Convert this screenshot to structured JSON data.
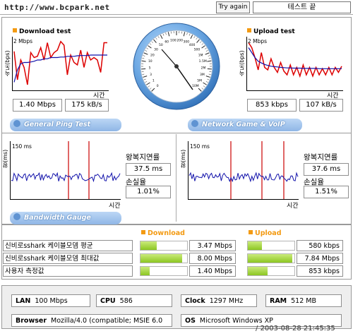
{
  "header": {
    "url": "http://www.bcpark.net",
    "try_again": "Try again",
    "test_end": "테스트 끝"
  },
  "download": {
    "title": "Download test",
    "y_label": "속도(bps)",
    "scale": "2 Mbps",
    "x_label": "시간",
    "mbps": "1.40 Mbps",
    "kbs": "175 kB/s",
    "speed_series": [
      1.55,
      0.4,
      1.2,
      0.9,
      0.2,
      1.5,
      1.3,
      1.35,
      1.7,
      1.2,
      1.9,
      1.3,
      1.5,
      1.6,
      1.95,
      1.8,
      0.6,
      1.4,
      1.1,
      1.0,
      1.6,
      0.9,
      1.5,
      1.2,
      1.3,
      1.2,
      0.7,
      1.9,
      1.9
    ],
    "avg_series": [
      0.3,
      0.8,
      1.05,
      1.1,
      1.1,
      1.12,
      1.15,
      1.2,
      1.2,
      1.25,
      1.25,
      1.3,
      1.3,
      1.3,
      1.32,
      1.32,
      1.35,
      1.35,
      1.35,
      1.37,
      1.38,
      1.38,
      1.38,
      1.4,
      1.4,
      1.4,
      1.4,
      1.4,
      1.4
    ]
  },
  "upload": {
    "title": "Upload test",
    "y_label": "속도(bps)",
    "scale": "2 Mbps",
    "x_label": "시간",
    "kbps": "853 kbps",
    "kbs": "107 kB/s",
    "speed_series": [
      1.9,
      1.7,
      1.3,
      0.8,
      1.5,
      0.9,
      0.8,
      1.25,
      0.9,
      0.7,
      1.1,
      0.75,
      0.6,
      1.0,
      0.6,
      0.9,
      0.55,
      1.0,
      0.6,
      0.9,
      0.55,
      0.9,
      0.6,
      0.85,
      0.6,
      0.9,
      0.6,
      0.9,
      0.7,
      0.95
    ],
    "avg_series": [
      1.7,
      1.5,
      1.3,
      1.15,
      1.08,
      1.02,
      0.98,
      0.95,
      0.93,
      0.92,
      0.9,
      0.89,
      0.88,
      0.88,
      0.87,
      0.87,
      0.87,
      0.86,
      0.86,
      0.86,
      0.86,
      0.86,
      0.85,
      0.85,
      0.85,
      0.85,
      0.85,
      0.85,
      0.85,
      0.85
    ]
  },
  "gauge": {
    "ticks": [
      "0",
      "1",
      "3",
      "5",
      "10",
      "20",
      "30",
      "50",
      "60",
      "100",
      "200",
      "300",
      "400",
      "500",
      "1M",
      "1.5M",
      "2M",
      "3M",
      "5M",
      "10M"
    ]
  },
  "ping": {
    "general_btn": "General Ping Test",
    "game_btn": "Network Game & VoIP Test",
    "left": {
      "y_label": "왕(ms)",
      "scale": "150 ms",
      "x_label": "시간",
      "rtt_label": "왕복지연률",
      "rtt_value": "37.5 ms",
      "loss_label": "손실율",
      "loss_value": "1.01%"
    },
    "right": {
      "y_label": "왕(ms)",
      "scale": "150 ms",
      "x_label": "시간",
      "rtt_label": "왕복지연률",
      "rtt_value": "37.6 ms",
      "loss_label": "손실율",
      "loss_value": "1.51%"
    }
  },
  "bandwidth": {
    "btn": "Bandwidth Gauge",
    "download_header": "Download",
    "upload_header": "Upload",
    "rows": [
      {
        "label": "신비로sshark 케이블모뎀 평균",
        "down_value": "3.47 Mbps",
        "down_fill": 0.35,
        "up_value": "580 kbps",
        "up_fill": 0.3
      },
      {
        "label": "신비로sshark 케이블모뎀 최대값",
        "down_value": "8.00 Mbps",
        "down_fill": 0.9,
        "up_value": "7.84 Mbps",
        "up_fill": 0.95
      },
      {
        "label": "사용자 측정값",
        "down_value": "1.40 Mbps",
        "down_fill": 0.2,
        "up_value": "853 kbps",
        "up_fill": 0.42
      }
    ]
  },
  "system": {
    "lan_label": "LAN",
    "lan_value": "100 Mbps",
    "cpu_label": "CPU",
    "cpu_value": "586",
    "clock_label": "Clock",
    "clock_value": "1297 MHz",
    "ram_label": "RAM",
    "ram_value": "512 MB",
    "browser_label": "Browser",
    "browser_value": "Mozilla/4.0 (compatible; MSIE 6.0",
    "os_label": "OS",
    "os_value": "Microsoft Windows XP"
  },
  "timestamp": "2003-08-28 21:45:35",
  "colors": {
    "accent_orange": "#f39a12",
    "series_red": "#dd0000",
    "series_blue": "#1010aa",
    "bar_green": "#8cc622"
  }
}
